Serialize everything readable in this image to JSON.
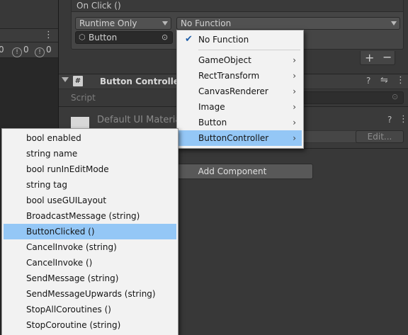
{
  "event": {
    "title": "On Click ()",
    "runtime_mode": "Runtime Only",
    "function_value": "No Function",
    "object_value": "Button"
  },
  "console_counts": {
    "logs": "0",
    "warnings": "0",
    "errors": "0"
  },
  "component": {
    "title": "Button Controller (",
    "script_label": "Script"
  },
  "material": {
    "name": "Default UI Materia",
    "edit_label": "Edit..."
  },
  "add_component_label": "Add Component",
  "function_menu": {
    "checked_item": "No Function",
    "items": [
      "GameObject",
      "RectTransform",
      "CanvasRenderer",
      "Image",
      "Button",
      "ButtonController"
    ],
    "highlighted": "ButtonController"
  },
  "method_menu": {
    "items": [
      "bool enabled",
      "string name",
      "bool runInEditMode",
      "string tag",
      "bool useGUILayout",
      "BroadcastMessage (string)",
      "ButtonClicked ()",
      "CancelInvoke (string)",
      "CancelInvoke ()",
      "SendMessage (string)",
      "SendMessageUpwards (string)",
      "StopAllCoroutines ()",
      "StopCoroutine (string)"
    ],
    "highlighted": "ButtonClicked ()"
  },
  "colors": {
    "selection": "#94c7f6",
    "menu_bg": "#f2f2f2",
    "editor_bg": "#383838"
  }
}
